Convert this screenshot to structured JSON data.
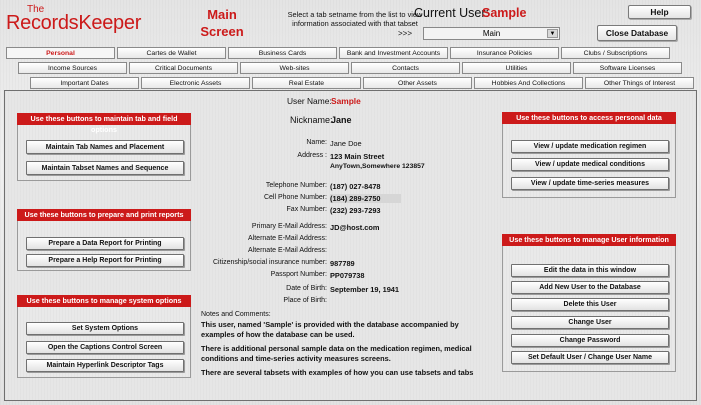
{
  "header": {
    "brand_top": "The",
    "brand_main": "RecordsKeeper",
    "screen_title_1": "Main",
    "screen_title_2": "Screen",
    "instructions": "Select a tab setname from the list to view information associated with that tabset",
    "arrows": ">>>",
    "tabset_value": "Main",
    "current_user_label": "Current User:",
    "current_user_value": "Sample",
    "help_label": "Help",
    "close_label": "Close Database"
  },
  "tabs_row1": [
    "Personal",
    "Cartes de Wallet",
    "Business Cards",
    "Bank and Investment Accounts",
    "Insurance Policies",
    "Clubs / Subscriptions"
  ],
  "tabs_row2": [
    "Income Sources",
    "Critical Documents",
    "Web-sites",
    "Contacts",
    "Utilities",
    "Software Licenses"
  ],
  "tabs_row3": [
    "Important Dates",
    "Electronic Assets",
    "Real Estate",
    "Other Assets",
    "Hobbies And Collections",
    "Other Things of Interest"
  ],
  "left_groups": {
    "tab_field": {
      "title": "Use these buttons to maintain tab and field options",
      "buttons": [
        "Maintain Tab Names and Placement",
        "Maintain Tabset Names and Sequence"
      ]
    },
    "reports": {
      "title": "Use these buttons to prepare and print reports",
      "buttons": [
        "Prepare a Data Report for Printing",
        "Prepare a Help Report for Printing"
      ]
    },
    "system": {
      "title": "Use these buttons to manage system options",
      "buttons": [
        "Set System Options",
        "Open the Captions Control Screen",
        "Maintain Hyperlink Descriptor Tags"
      ]
    }
  },
  "right_groups": {
    "personal": {
      "title": "Use these buttons to access personal data",
      "buttons": [
        "View / update medication regimen",
        "View / update medical conditions",
        "View / update time-series measures"
      ]
    },
    "user": {
      "title": "Use these buttons to manage User information",
      "buttons": [
        "Edit the data in this window",
        "Add New User to the Database",
        "Delete this User",
        "Change User",
        "Change Password",
        "Set Default User / Change User Name"
      ]
    }
  },
  "profile": {
    "username_label": "User Name:",
    "username_value": "Sample",
    "nickname_label": "Nickname:",
    "nickname_value": "Jane",
    "name_label": "Name:",
    "name_value": "Jane  Doe",
    "address_label": "Address :",
    "address_line1": "123 Main Street",
    "address_line2": "AnyTown,Somewhere 123857",
    "phone_label": "Telephone Number:",
    "phone_value": "(187) 027-8478",
    "cell_label": "Cell Phone Number:",
    "cell_value": "(184) 289-2750",
    "fax_label": "Fax Number:",
    "fax_value": "(232) 293-7293",
    "email_label": "Primary E-Mail Address:",
    "email_value": "JD@host.com",
    "alt_email1_label": "Alternate E-Mail Address:",
    "alt_email2_label": "Alternate E-Mail Address:",
    "citizen_label": "Citizenship/social insurance number:",
    "citizen_value": "987789",
    "passport_label": "Passport Number:",
    "passport_value": "PP079738",
    "dob_label": "Date of Birth:",
    "dob_value": "September 19, 1941",
    "pob_label": "Place of Birth:",
    "notes_label": "Notes and Comments:",
    "notes_p1": "This user, named 'Sample' is provided with the database accompanied by examples of how the database can be used.",
    "notes_p2": "There is additional personal sample data on the medication regimen, medical conditions and time-series activity measures screens.",
    "notes_p3": "There are several tabsets with examples of how you can use tabsets and tabs"
  },
  "colors": {
    "accent_red": "#cc1a1a",
    "background": "#e9e9e9"
  }
}
